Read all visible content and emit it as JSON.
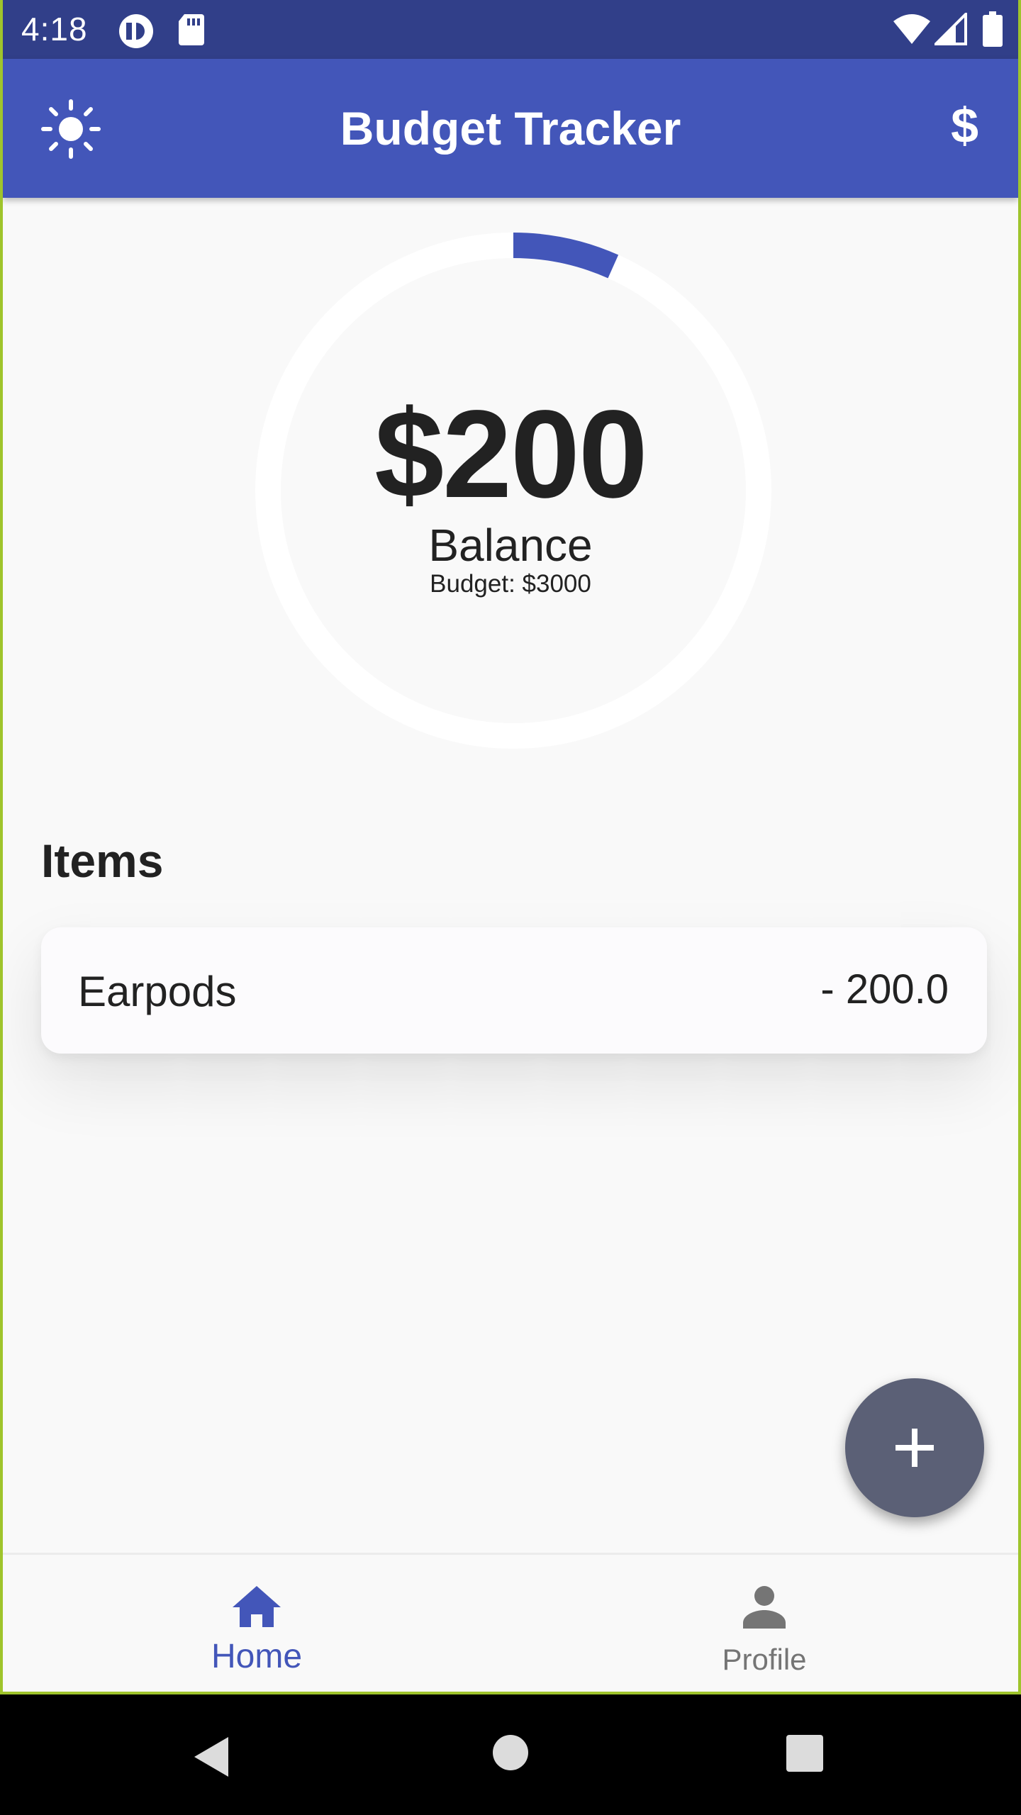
{
  "status_bar": {
    "time": "4:18",
    "icons": [
      "app-notification-icon",
      "sd-card-icon",
      "wifi-icon",
      "cell-signal-icon",
      "battery-icon"
    ]
  },
  "app_bar": {
    "title": "Budget Tracker",
    "left_icon": "theme-brightness-icon",
    "right_label": "$"
  },
  "balance": {
    "amount": "$200",
    "label": "Balance",
    "budget": "Budget: $3000",
    "spent_fraction": 0.0667,
    "accent_color": "#4356b9"
  },
  "items": {
    "heading": "Items",
    "list": [
      {
        "name": "Earpods",
        "amount": "- 200.0"
      }
    ]
  },
  "fab": {
    "icon": "plus-icon"
  },
  "bottom_nav": {
    "items": [
      {
        "label": "Home",
        "icon": "home-icon",
        "active": true
      },
      {
        "label": "Profile",
        "icon": "person-icon",
        "active": false
      }
    ],
    "active_color": "#4356b9"
  },
  "system_nav": {
    "icons": [
      "back-icon",
      "home-circle-icon",
      "recents-icon"
    ]
  }
}
